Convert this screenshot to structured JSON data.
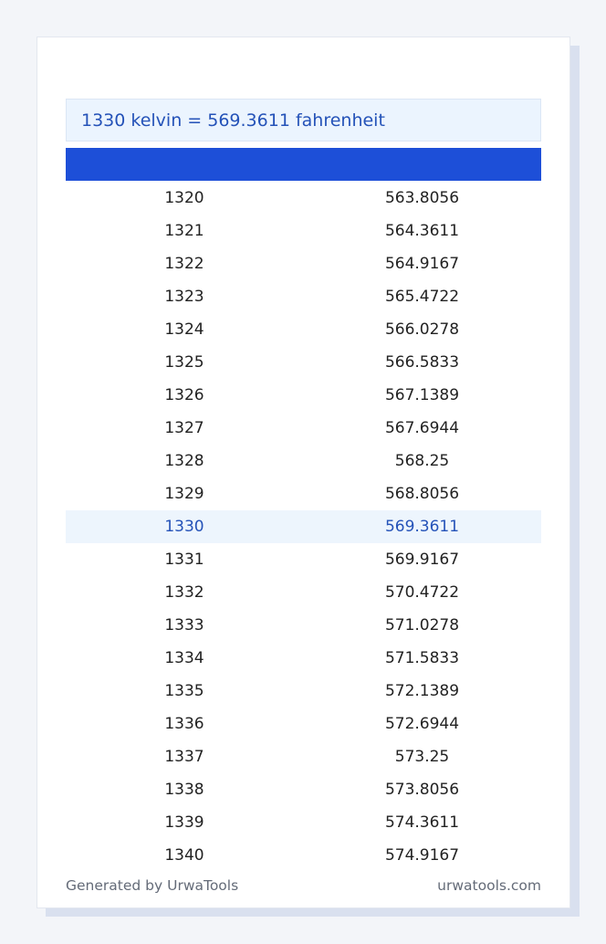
{
  "result": "1330 kelvin = 569.3611 fahrenheit",
  "table": {
    "headers": [
      "",
      ""
    ],
    "rows": [
      [
        "1320",
        "563.8056"
      ],
      [
        "1321",
        "564.3611"
      ],
      [
        "1322",
        "564.9167"
      ],
      [
        "1323",
        "565.4722"
      ],
      [
        "1324",
        "566.0278"
      ],
      [
        "1325",
        "566.5833"
      ],
      [
        "1326",
        "567.1389"
      ],
      [
        "1327",
        "567.6944"
      ],
      [
        "1328",
        "568.25"
      ],
      [
        "1329",
        "568.8056"
      ],
      [
        "1330",
        "569.3611"
      ],
      [
        "1331",
        "569.9167"
      ],
      [
        "1332",
        "570.4722"
      ],
      [
        "1333",
        "571.0278"
      ],
      [
        "1334",
        "571.5833"
      ],
      [
        "1335",
        "572.1389"
      ],
      [
        "1336",
        "572.6944"
      ],
      [
        "1337",
        "573.25"
      ],
      [
        "1338",
        "573.8056"
      ],
      [
        "1339",
        "574.3611"
      ],
      [
        "1340",
        "574.9167"
      ]
    ],
    "highlight_value": "1330"
  },
  "footer": {
    "left": "Generated by UrwaTools",
    "right": "urwatools.com"
  },
  "colors": {
    "accent": "#1d4fd8",
    "highlight_bg": "#edf5fd",
    "highlight_text": "#2452b8"
  }
}
